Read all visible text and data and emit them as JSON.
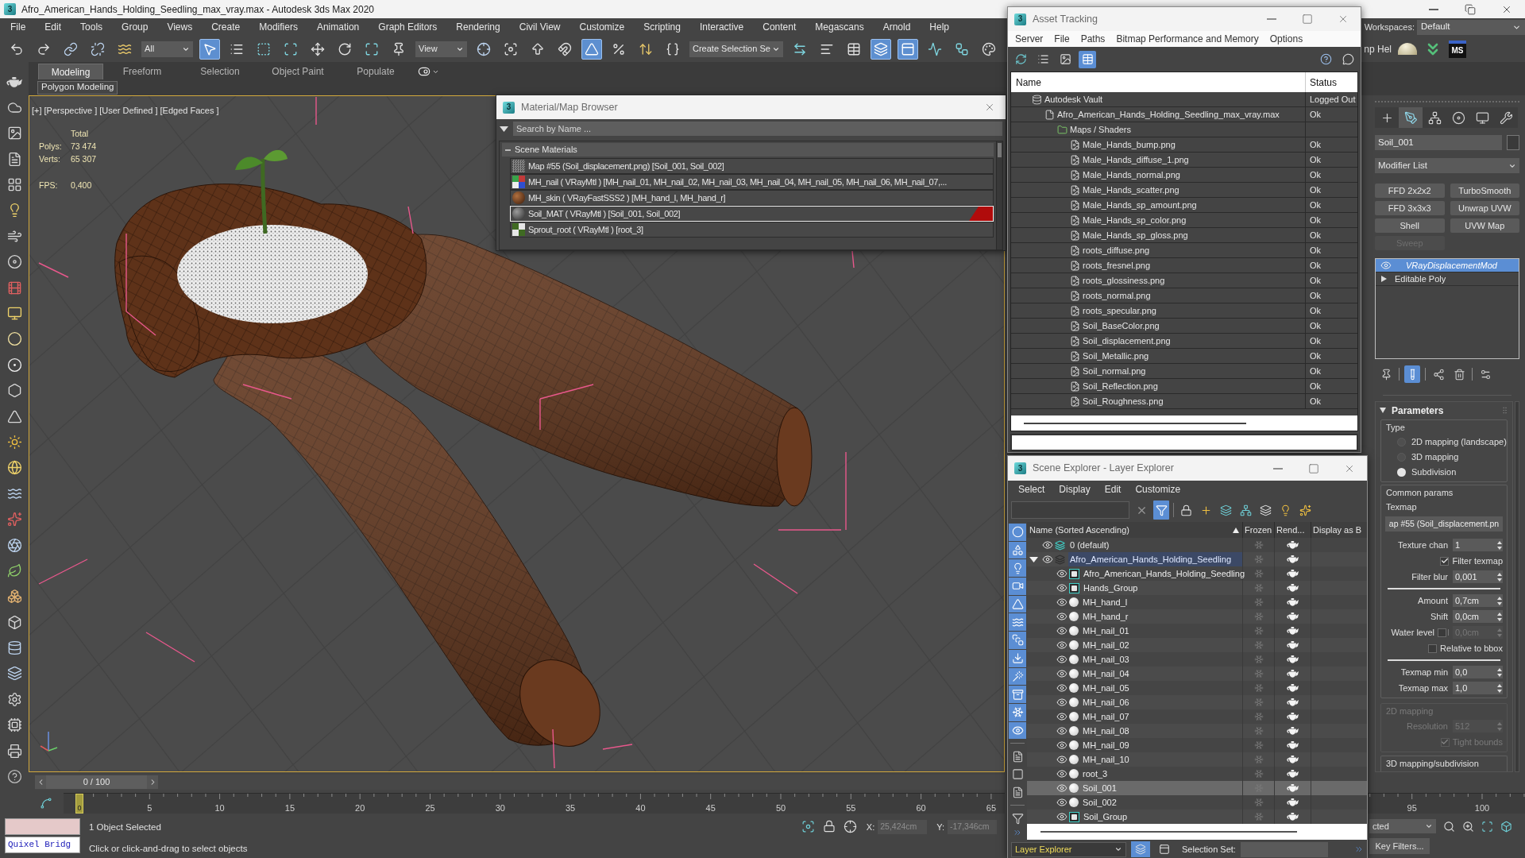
{
  "window": {
    "logo": "3",
    "title": "Afro_American_Hands_Holding_Seedling_max_vray.max - Autodesk 3ds Max 2020"
  },
  "menu": [
    "File",
    "Edit",
    "Tools",
    "Group",
    "Views",
    "Create",
    "Modifiers",
    "Animation",
    "Graph Editors",
    "Rendering",
    "Civil View",
    "Customize",
    "Scripting",
    "Interactive",
    "Content",
    "Megascans",
    "Arnold",
    "Help"
  ],
  "workspaces": {
    "label": "Workspaces:",
    "value": "Default"
  },
  "toolbar": {
    "items": [
      {
        "kind": "button",
        "selected": false
      },
      {
        "kind": "button",
        "selected": false
      },
      {
        "kind": "button",
        "selected": false
      },
      {
        "kind": "button",
        "selected": false
      },
      {
        "kind": "button",
        "selected": false
      },
      {
        "kind": "dropdown",
        "value": "All"
      },
      {
        "kind": "button",
        "selected": true
      },
      {
        "kind": "button",
        "selected": false
      },
      {
        "kind": "button",
        "selected": false
      },
      {
        "kind": "button",
        "selected": false
      },
      {
        "kind": "button",
        "selected": false
      },
      {
        "kind": "button",
        "selected": false
      },
      {
        "kind": "button",
        "selected": false
      },
      {
        "kind": "button",
        "selected": false
      },
      {
        "kind": "dropdown",
        "value": "View"
      },
      {
        "kind": "button",
        "selected": false
      },
      {
        "kind": "button",
        "selected": false
      },
      {
        "kind": "button",
        "selected": false
      },
      {
        "kind": "button",
        "selected": false
      },
      {
        "kind": "button",
        "selected": true
      },
      {
        "kind": "button",
        "selected": false
      },
      {
        "kind": "button",
        "selected": false
      },
      {
        "kind": "button",
        "selected": false
      },
      {
        "kind": "dropdown",
        "value": "Create Selection Se"
      },
      {
        "kind": "button",
        "selected": false
      },
      {
        "kind": "button",
        "selected": false
      },
      {
        "kind": "button",
        "selected": false
      },
      {
        "kind": "button",
        "selected": true
      },
      {
        "kind": "button",
        "selected": true
      },
      {
        "kind": "button",
        "selected": false
      },
      {
        "kind": "button",
        "selected": false
      },
      {
        "kind": "button",
        "selected": false
      }
    ],
    "trailing_text": "np Hel",
    "badge": "MS"
  },
  "ribbon": {
    "tabs": [
      {
        "label": "Modeling",
        "selected": true
      },
      {
        "label": "Freeform",
        "selected": false
      },
      {
        "label": "Selection",
        "selected": false
      },
      {
        "label": "Object Paint",
        "selected": false
      },
      {
        "label": "Populate",
        "selected": false
      }
    ],
    "panel": "Polygon Modeling"
  },
  "viewport": {
    "active": true,
    "labels": [
      "[+]",
      "[Perspective ]",
      "[User Defined ]",
      "[Edged Faces ]"
    ],
    "stats": {
      "header": "Total",
      "rows": [
        {
          "label": "Polys:",
          "value": "73 474"
        },
        {
          "label": "Verts:",
          "value": "65 307"
        }
      ]
    },
    "fps": {
      "label": "FPS:",
      "value": "0,400"
    }
  },
  "material_browser": {
    "logo": "3",
    "title": "Material/Map Browser",
    "search": {
      "placeholder": "Search by Name ..."
    },
    "group": {
      "title": "Scene Materials",
      "expanded": true,
      "items": [
        {
          "label": "Map #55 (Soil_displacement.png) [Soil_001, Soil_002]",
          "selected": false
        },
        {
          "label": "MH_nail ( VRayMtl ) [MH_nail_01, MH_nail_02, MH_nail_03, MH_nail_04, MH_nail_05, MH_nail_06, MH_nail_07,...",
          "selected": false
        },
        {
          "label": "MH_skin ( VRayFastSSS2 ) [MH_hand_l, MH_hand_r]",
          "selected": false
        },
        {
          "label": "Soil_MAT ( VRayMtl ) [Soil_001, Soil_002]",
          "selected": true
        },
        {
          "label": "Sprout_root ( VRayMtl ) [root_3]",
          "selected": false
        }
      ]
    }
  },
  "asset_tracking": {
    "logo": "3",
    "title": "Asset Tracking",
    "menu": [
      "Server",
      "File",
      "Paths",
      "Bitmap Performance and Memory",
      "Options"
    ],
    "tools": [
      {
        "selected": false
      },
      {
        "selected": false
      },
      {
        "selected": false
      },
      {
        "selected": true
      },
      {
        "selected": false
      },
      {
        "selected": false
      }
    ],
    "columns": [
      "Name",
      "Status"
    ],
    "rows": [
      {
        "kind": "vault",
        "name": "Autodesk Vault",
        "status": "Logged Out",
        "children": [
          {
            "kind": "scene",
            "name": "Afro_American_Hands_Holding_Seedling_max_vray.max",
            "status": "Ok",
            "children": [
              {
                "kind": "folder",
                "name": "Maps / Shaders",
                "children": [
                  {
                    "kind": "bitmap",
                    "name": "Male_Hands_bump.png",
                    "status": "Ok"
                  },
                  {
                    "kind": "bitmap",
                    "name": "Male_Hands_diffuse_1.png",
                    "status": "Ok"
                  },
                  {
                    "kind": "bitmap",
                    "name": "Male_Hands_normal.png",
                    "status": "Ok"
                  },
                  {
                    "kind": "bitmap",
                    "name": "Male_Hands_scatter.png",
                    "status": "Ok"
                  },
                  {
                    "kind": "bitmap",
                    "name": "Male_Hands_sp_amount.png",
                    "status": "Ok"
                  },
                  {
                    "kind": "bitmap",
                    "name": "Male_Hands_sp_color.png",
                    "status": "Ok"
                  },
                  {
                    "kind": "bitmap",
                    "name": "Male_Hands_sp_gloss.png",
                    "status": "Ok"
                  },
                  {
                    "kind": "bitmap",
                    "name": "roots_diffuse.png",
                    "status": "Ok"
                  },
                  {
                    "kind": "bitmap",
                    "name": "roots_fresnel.png",
                    "status": "Ok"
                  },
                  {
                    "kind": "bitmap",
                    "name": "roots_glossiness.png",
                    "status": "Ok"
                  },
                  {
                    "kind": "bitmap",
                    "name": "roots_normal.png",
                    "status": "Ok"
                  },
                  {
                    "kind": "bitmap",
                    "name": "roots_specular.png",
                    "status": "Ok"
                  },
                  {
                    "kind": "bitmap",
                    "name": "Soil_BaseColor.png",
                    "status": "Ok"
                  },
                  {
                    "kind": "bitmap",
                    "name": "Soil_displacement.png",
                    "status": "Ok"
                  },
                  {
                    "kind": "bitmap",
                    "name": "Soil_Metallic.png",
                    "status": "Ok"
                  },
                  {
                    "kind": "bitmap",
                    "name": "Soil_normal.png",
                    "status": "Ok"
                  },
                  {
                    "kind": "bitmap",
                    "name": "Soil_Reflection.png",
                    "status": "Ok"
                  },
                  {
                    "kind": "bitmap",
                    "name": "Soil_Roughness.png",
                    "status": "Ok"
                  }
                ]
              }
            ]
          }
        ]
      }
    ]
  },
  "scene_explorer": {
    "logo": "3",
    "title": "Scene Explorer - Layer Explorer",
    "menu": [
      "Select",
      "Display",
      "Edit",
      "Customize"
    ],
    "tools": [
      {
        "selected": false
      },
      {
        "selected": true
      },
      {
        "selected": false
      },
      {
        "selected": false
      },
      {
        "selected": false
      },
      {
        "selected": false
      },
      {
        "selected": false
      },
      {
        "selected": false
      },
      {
        "selected": false
      }
    ],
    "side_tools": [
      {
        "selected": true
      },
      {
        "selected": true
      },
      {
        "selected": true
      },
      {
        "selected": true
      },
      {
        "selected": true
      },
      {
        "selected": true
      },
      {
        "selected": true
      },
      {
        "selected": true
      },
      {
        "selected": true
      },
      {
        "selected": true
      },
      {
        "selected": true
      },
      {
        "selected": true
      },
      {
        "selected": false
      },
      {
        "selected": false
      },
      {
        "selected": false
      },
      {
        "selected": false
      }
    ],
    "columns": [
      "Name (Sorted Ascending)",
      "Frozen",
      "Rend...",
      "Display as B"
    ],
    "rows": [
      {
        "kind": "layer",
        "name": "0 (default)",
        "current": true,
        "highlighted": false,
        "selected": false,
        "visible": true,
        "frozen": false,
        "renderable": true
      },
      {
        "kind": "layer",
        "name": "Afro_American_Hands_Holding_Seedling",
        "current": false,
        "highlighted": true,
        "selected": false,
        "visible": true,
        "frozen": false,
        "renderable": true,
        "expanded": true,
        "children": [
          {
            "kind": "group",
            "name": "Afro_American_Hands_Holding_Seedling",
            "selected": false,
            "visible": true,
            "frozen": false,
            "renderable": true
          },
          {
            "kind": "group",
            "name": "Hands_Group",
            "selected": false,
            "visible": true,
            "frozen": false,
            "renderable": true
          },
          {
            "kind": "object",
            "name": "MH_hand_l",
            "selected": false,
            "visible": true,
            "frozen": false,
            "renderable": true
          },
          {
            "kind": "object",
            "name": "MH_hand_r",
            "selected": false,
            "visible": true,
            "frozen": false,
            "renderable": true
          },
          {
            "kind": "object",
            "name": "MH_nail_01",
            "selected": false,
            "visible": true,
            "frozen": false,
            "renderable": true
          },
          {
            "kind": "object",
            "name": "MH_nail_02",
            "selected": false,
            "visible": true,
            "frozen": false,
            "renderable": true
          },
          {
            "kind": "object",
            "name": "MH_nail_03",
            "selected": false,
            "visible": true,
            "frozen": false,
            "renderable": true
          },
          {
            "kind": "object",
            "name": "MH_nail_04",
            "selected": false,
            "visible": true,
            "frozen": false,
            "renderable": true
          },
          {
            "kind": "object",
            "name": "MH_nail_05",
            "selected": false,
            "visible": true,
            "frozen": false,
            "renderable": true
          },
          {
            "kind": "object",
            "name": "MH_nail_06",
            "selected": false,
            "visible": true,
            "frozen": false,
            "renderable": true
          },
          {
            "kind": "object",
            "name": "MH_nail_07",
            "selected": false,
            "visible": true,
            "frozen": false,
            "renderable": true
          },
          {
            "kind": "object",
            "name": "MH_nail_08",
            "selected": false,
            "visible": true,
            "frozen": false,
            "renderable": true
          },
          {
            "kind": "object",
            "name": "MH_nail_09",
            "selected": false,
            "visible": true,
            "frozen": false,
            "renderable": true
          },
          {
            "kind": "object",
            "name": "MH_nail_10",
            "selected": false,
            "visible": true,
            "frozen": false,
            "renderable": true
          },
          {
            "kind": "object",
            "name": "root_3",
            "selected": false,
            "visible": true,
            "frozen": false,
            "renderable": true
          },
          {
            "kind": "object",
            "name": "Soil_001",
            "selected": true,
            "visible": true,
            "frozen": false,
            "renderable": true
          },
          {
            "kind": "object",
            "name": "Soil_002",
            "selected": false,
            "visible": true,
            "frozen": false,
            "renderable": true
          },
          {
            "kind": "group",
            "name": "Soil_Group",
            "selected": false,
            "visible": true,
            "frozen": false,
            "renderable": true
          }
        ]
      }
    ],
    "footer": {
      "explorer": "Layer Explorer",
      "tools": [
        {
          "selected": true
        },
        {
          "selected": false
        }
      ],
      "selection_set_label": "Selection Set:"
    }
  },
  "command_panel": {
    "tabs": [
      {
        "selected": false
      },
      {
        "selected": true
      },
      {
        "selected": false
      },
      {
        "selected": false
      },
      {
        "selected": false
      },
      {
        "selected": false
      }
    ],
    "object_name": "Soil_001",
    "modifier_list": "Modifier List",
    "modifier_buttons": [
      {
        "label": "FFD 2x2x2",
        "disabled": false
      },
      {
        "label": "TurboSmooth",
        "disabled": false
      },
      {
        "label": "FFD 3x3x3",
        "disabled": false
      },
      {
        "label": "Unwrap UVW",
        "disabled": false
      },
      {
        "label": "Shell",
        "disabled": false
      },
      {
        "label": "UVW Map",
        "disabled": false
      },
      {
        "label": "Sweep",
        "disabled": true
      }
    ],
    "stack": [
      {
        "kind": "modifier",
        "label": "VRayDisplacementMod",
        "selected": true,
        "enabled": true
      },
      {
        "kind": "base",
        "label": "Editable Poly",
        "selected": false,
        "expanded": false
      }
    ],
    "stack_tools": [
      {
        "selected": false
      },
      {
        "selected": true
      },
      {
        "selected": false
      },
      {
        "selected": false
      },
      {
        "selected": false
      }
    ],
    "rollout": {
      "title": "Parameters",
      "expanded": true,
      "groups": [
        {
          "kind": "radio",
          "title": "Type",
          "options": [
            {
              "label": "2D mapping (landscape)",
              "selected": false
            },
            {
              "label": "3D mapping",
              "selected": false
            },
            {
              "label": "Subdivision",
              "selected": true
            }
          ]
        },
        {
          "kind": "params",
          "title": "Common params",
          "disabled": false,
          "texmap_label": "Texmap",
          "texmap": "ap #55 (Soil_displacement.pn",
          "sections": [
            {
              "rows": [
                {
                  "kind": "spinner",
                  "label": "Texture chan",
                  "value": "1"
                },
                {
                  "kind": "checkbox",
                  "label": "Filter texmap",
                  "checked": true
                },
                {
                  "kind": "spinner",
                  "label": "Filter blur",
                  "value": "0,001"
                }
              ]
            },
            {
              "rows": [
                {
                  "kind": "spinner",
                  "label": "Amount",
                  "value": "0,7cm"
                },
                {
                  "kind": "spinner",
                  "label": "Shift",
                  "value": "0,0cm"
                },
                {
                  "kind": "check_spinner",
                  "label": "Water level",
                  "checked": false,
                  "value": "0,0cm"
                },
                {
                  "kind": "checkbox",
                  "label": "Relative to bbox",
                  "checked": false
                }
              ]
            },
            {
              "rows": [
                {
                  "kind": "spinner",
                  "label": "Texmap min",
                  "value": "0,0"
                },
                {
                  "kind": "spinner",
                  "label": "Texmap max",
                  "value": "1,0"
                }
              ]
            }
          ]
        },
        {
          "kind": "params",
          "title": "2D mapping",
          "disabled": true,
          "sections": [
            {
              "rows": [
                {
                  "kind": "spinner",
                  "label": "Resolution",
                  "value": "512"
                },
                {
                  "kind": "checkbox",
                  "label": "Tight bounds",
                  "checked": true
                }
              ]
            }
          ]
        },
        {
          "kind": "header",
          "title": "3D mapping/subdivision"
        }
      ]
    }
  },
  "timeline": {
    "slider": "0 / 100",
    "level": 0,
    "current_frame": "0",
    "ticks": [
      "5",
      "10",
      "15",
      "20",
      "25",
      "30",
      "35",
      "40",
      "45",
      "50",
      "55",
      "60",
      "65"
    ],
    "end_ticks": [
      "95",
      "100"
    ]
  },
  "status_bar": {
    "listener_input": "Quixel Bridg",
    "selection": "1 Object Selected",
    "prompt": "Click or click-and-drag to select objects",
    "coordinates": [
      {
        "label": "X:",
        "value": "25,424cm",
        "disabled": true
      },
      {
        "label": "Y:",
        "value": "-17,346cm",
        "disabled": true
      }
    ],
    "selection_filter": "cted",
    "key_filters": "Key Filters..."
  }
}
